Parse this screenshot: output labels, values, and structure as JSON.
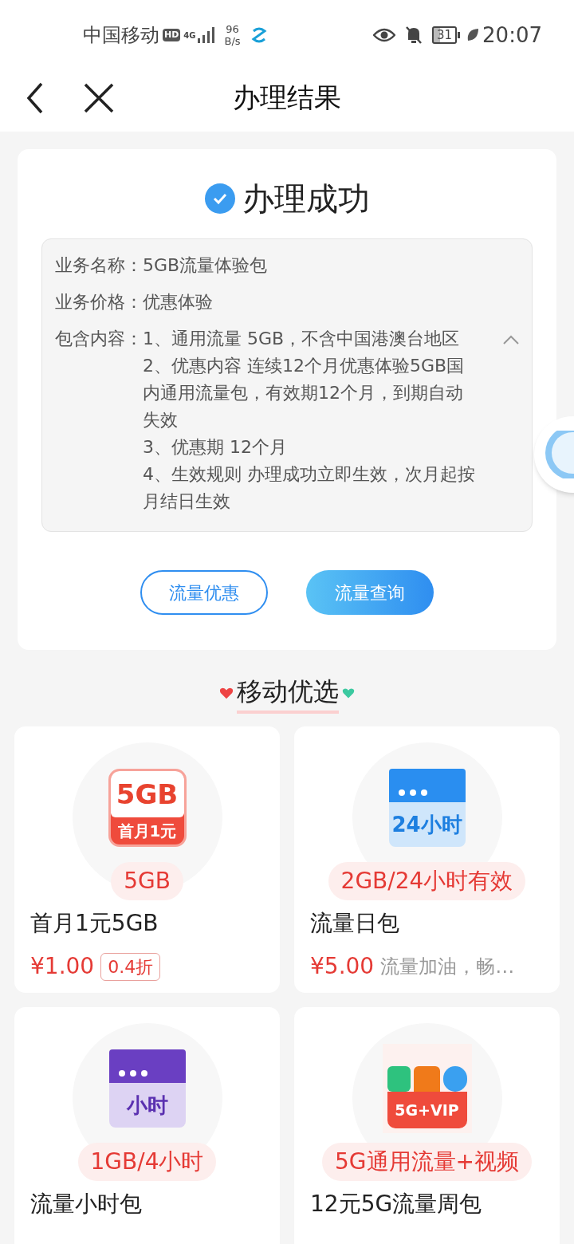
{
  "status_bar": {
    "carrier": "中国移动",
    "hd": "HD",
    "network": "4G",
    "speed_value": "96",
    "speed_unit": "B/s",
    "battery": "31",
    "time": "20:07"
  },
  "header": {
    "title": "办理结果"
  },
  "result": {
    "title": "办理成功",
    "details": [
      {
        "label": "业务名称：",
        "lines": [
          "5GB流量体验包"
        ]
      },
      {
        "label": "业务价格：",
        "lines": [
          "优惠体验"
        ]
      },
      {
        "label": "包含内容：",
        "lines": [
          "1、通用流量 5GB，不含中国港澳台地区",
          "2、优惠内容 连续12个月优惠体验5GB国内通用流量包，有效期12个月，到期自动失效",
          "3、优惠期 12个月",
          "4、生效规则 办理成功立即生效，次月起按月结日生效"
        ],
        "expanded": true
      }
    ],
    "buttons": [
      {
        "label": "流量优惠",
        "kind": "outline"
      },
      {
        "label": "流量查询",
        "kind": "filled"
      }
    ]
  },
  "section": {
    "title": "移动优选"
  },
  "products": [
    {
      "kind": "data_card",
      "icon_text": [
        "5GB",
        "首月1元"
      ],
      "tag": "5GB",
      "name": "首月1元5GB",
      "price": "¥1.00",
      "discount": "0.4折"
    },
    {
      "kind": "day_calendar",
      "icon_text": [
        "24小时"
      ],
      "tag": "2GB/24小时有效",
      "name": "流量日包",
      "price": "¥5.00",
      "desc": "流量加油，畅…"
    },
    {
      "kind": "hour_calendar",
      "icon_text": [
        "小时"
      ],
      "tag": "1GB/4小时",
      "name": "流量小时包"
    },
    {
      "kind": "video_bundle",
      "icon_text": [
        "5G+VIP"
      ],
      "tag": "5G通用流量+视频",
      "name": "12元5G流量周包"
    }
  ]
}
